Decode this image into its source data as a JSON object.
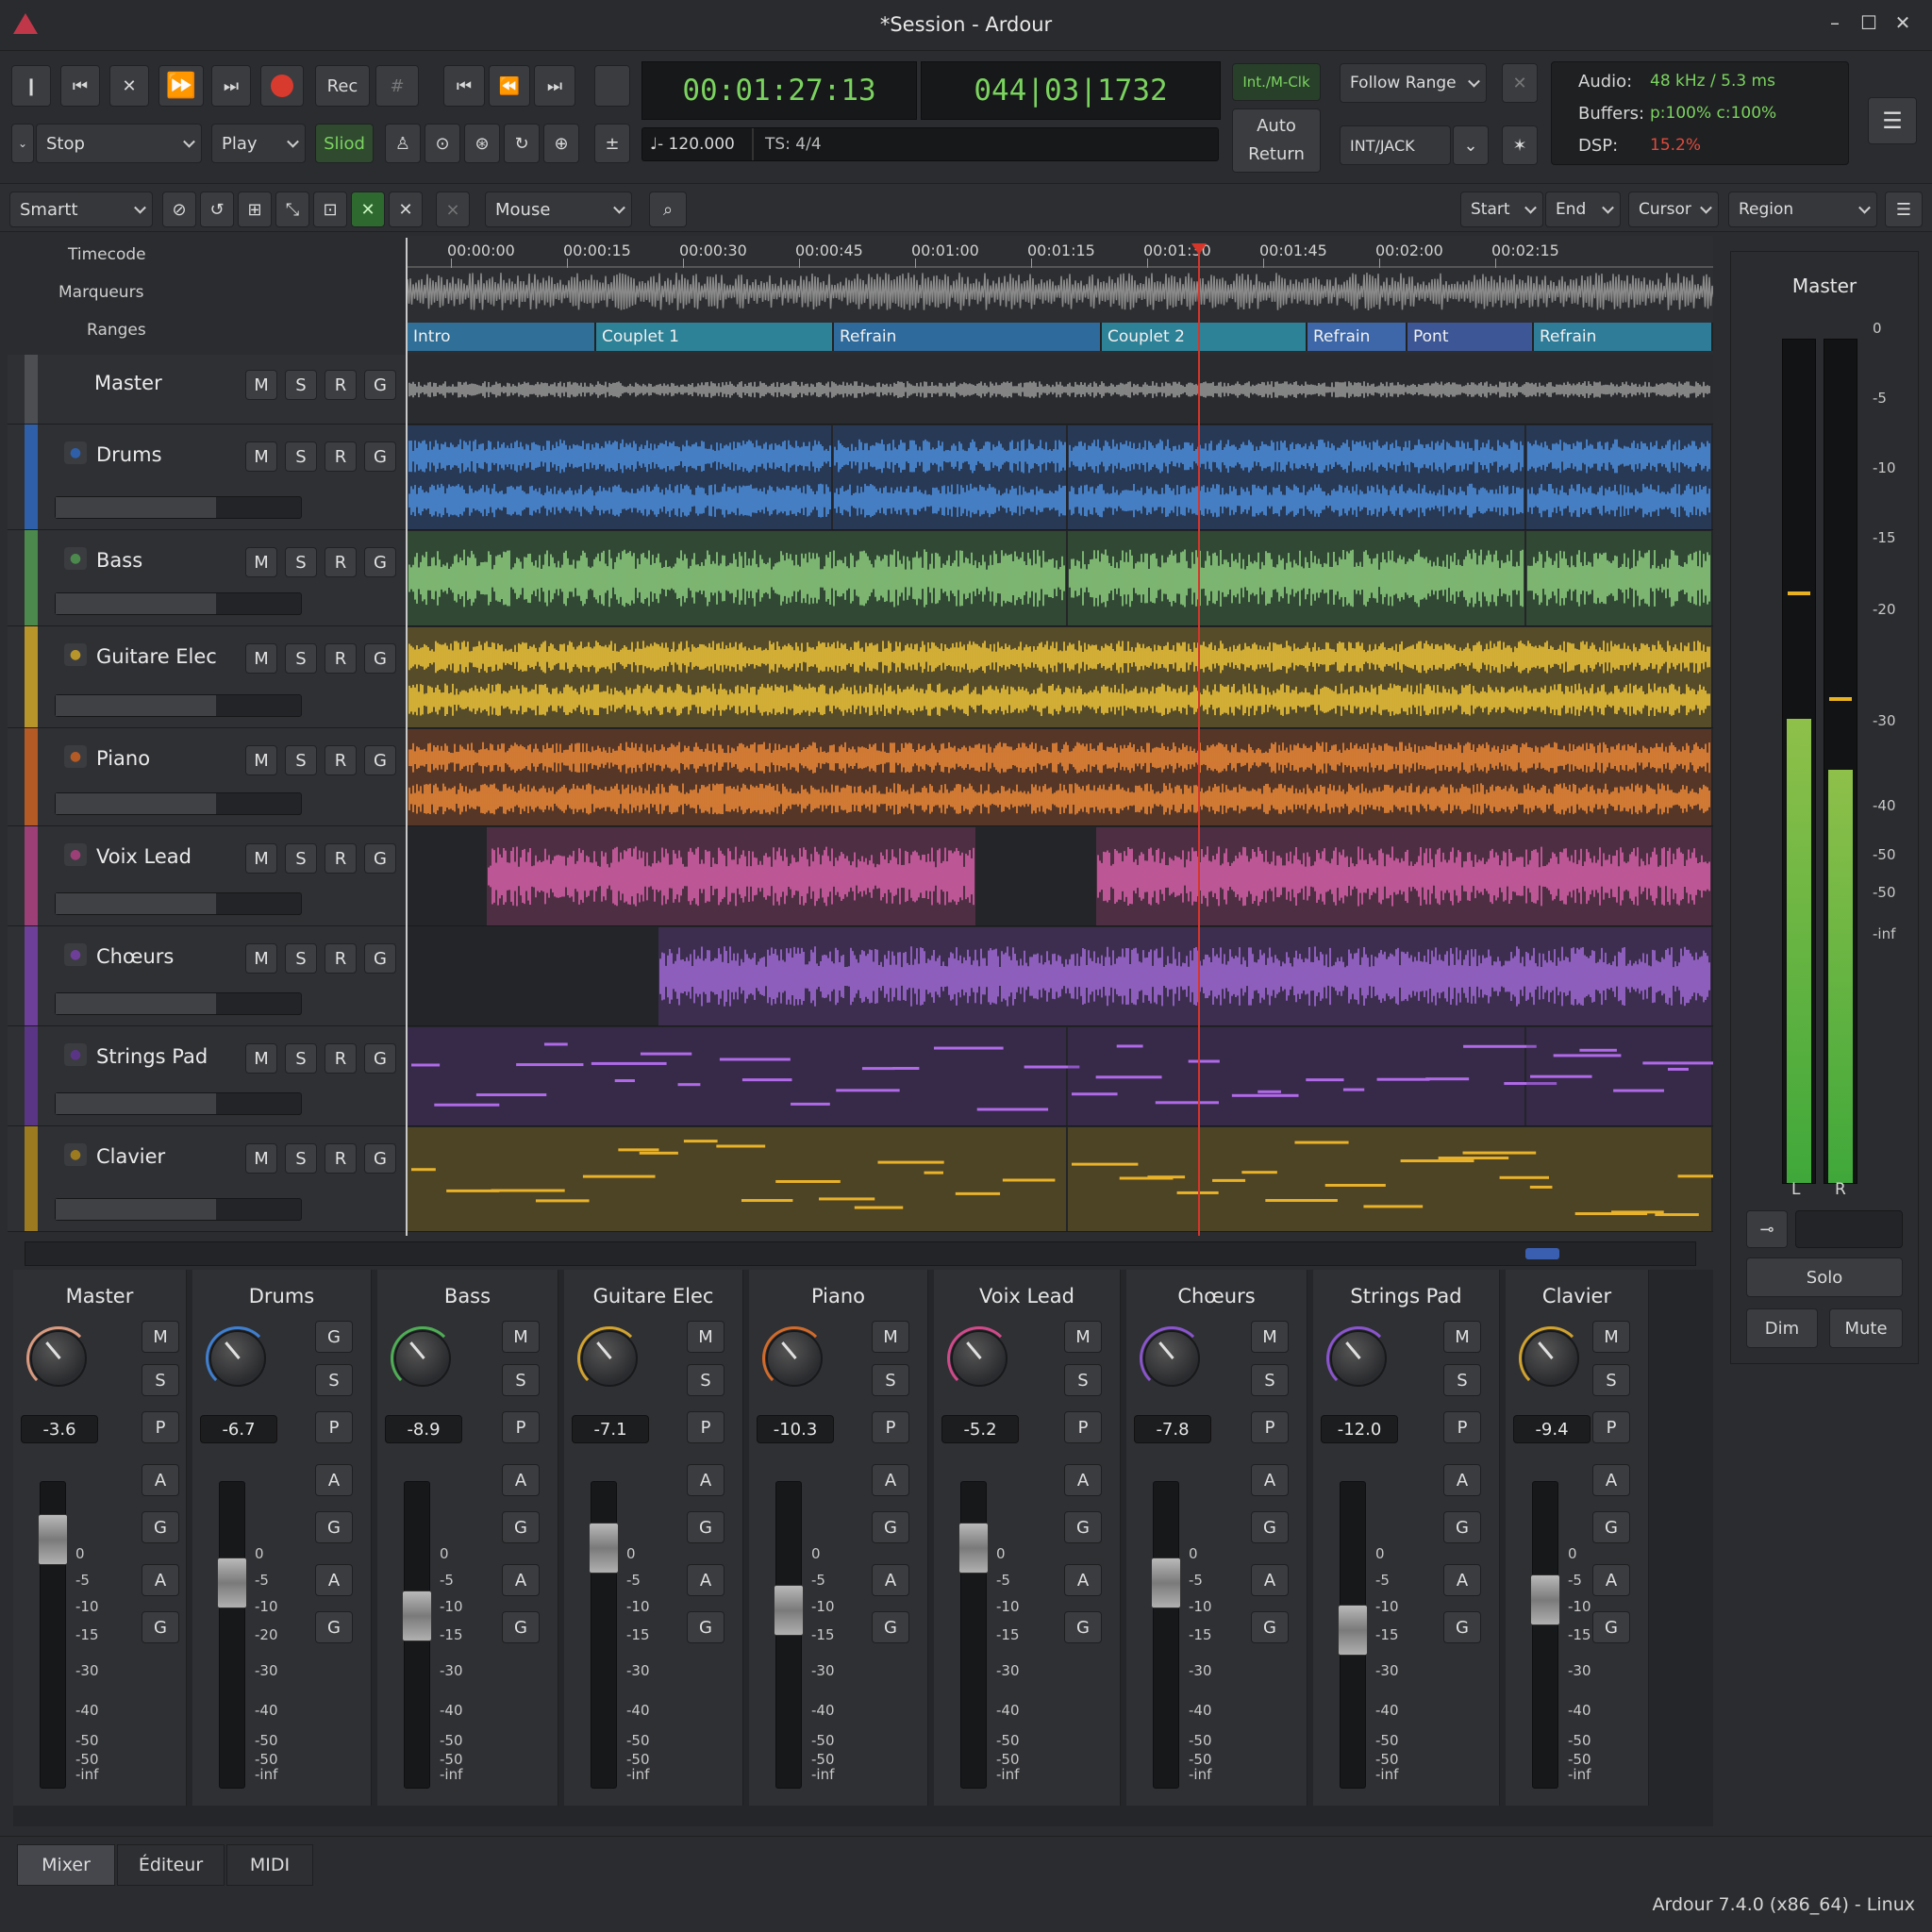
{
  "window": {
    "title": "*Session - Ardour",
    "min": "–",
    "max": "☐",
    "close": "✕"
  },
  "transport": {
    "rec_label": "Rec",
    "primary_clock": "00:01:27:13",
    "secondary_clock": "044|03|1732",
    "sync_label": "Int./M-Clk",
    "follow_range": "Follow Range",
    "auto_return_1": "Auto",
    "auto_return_2": "Return",
    "jack": "INT/JACK",
    "stop_label": "Stop",
    "play_label": "Play",
    "slide_label": "Sliod",
    "tempo": "♩- 120.000",
    "ts": "TS:  4/4"
  },
  "status": {
    "audio_label": "Audio:",
    "audio_value": "48 kHz / 5.3 ms",
    "buffers_label": "Buffers:",
    "buffers_value": "p:100% c:100%",
    "dsp_label": "DSP:",
    "dsp_value": "15.2%"
  },
  "edit_toolbar": {
    "edit_mode": "Smartt",
    "mouse_mode": "Mouse",
    "start": "Start",
    "end": "End",
    "cursor": "Cursor",
    "region": "Region"
  },
  "ruler": {
    "labels": [
      "Timecode",
      "Marqueurs",
      "Ranges"
    ],
    "ticks": [
      "00:00:00",
      "00:00:15",
      "00:00:30",
      "00:00:45",
      "00:01:00",
      "00:01:15",
      "00:01:30",
      "00:01:45",
      "00:02:00",
      "00:02:15"
    ],
    "ranges": [
      {
        "name": "Intro",
        "color": "#2f6f98"
      },
      {
        "name": "Couplet 1",
        "color": "#2e8298"
      },
      {
        "name": "Refrain",
        "color": "#2e6a9c"
      },
      {
        "name": "Couplet 2",
        "color": "#2e8298"
      },
      {
        "name": "Refrain",
        "color": "#3d67a8"
      },
      {
        "name": "Pont",
        "color": "#3d5796"
      },
      {
        "name": "Refrain",
        "color": "#2e7c98"
      }
    ]
  },
  "tracks": [
    {
      "name": "Master",
      "color": "#4d4e52",
      "btns": [
        "M",
        "S",
        "R",
        "G"
      ]
    },
    {
      "name": "Drums",
      "color": "#2f5fa8",
      "btns": [
        "M",
        "S",
        "R",
        "G"
      ]
    },
    {
      "name": "Bass",
      "color": "#4b8a4c",
      "btns": [
        "M",
        "S",
        "R",
        "G"
      ]
    },
    {
      "name": "Guitare Elec",
      "color": "#b8952a",
      "btns": [
        "M",
        "S",
        "R",
        "G"
      ]
    },
    {
      "name": "Piano",
      "color": "#b45a25",
      "btns": [
        "M",
        "S",
        "R",
        "G"
      ]
    },
    {
      "name": "Voix Lead",
      "color": "#9b3f76",
      "btns": [
        "M",
        "S",
        "R",
        "G"
      ]
    },
    {
      "name": "Chœurs",
      "color": "#6d3f98",
      "btns": [
        "M",
        "S",
        "R",
        "G"
      ]
    },
    {
      "name": "Strings Pad",
      "color": "#5a3585",
      "btns": [
        "M",
        "S",
        "R",
        "G"
      ]
    },
    {
      "name": "Clavier",
      "color": "#9c7a1f",
      "btns": [
        "M",
        "S",
        "R",
        "G"
      ]
    }
  ],
  "master_meter": {
    "title": "Master",
    "scale": [
      "0",
      "-5",
      "-10",
      "-15",
      "-20",
      "-30",
      "-40",
      "-50",
      "-50",
      "-inf"
    ],
    "left_label": "L",
    "right_label": "R",
    "solo": "Solo",
    "dim": "Dim",
    "mute": "Mute",
    "level_left": 0.55,
    "level_right": 0.49
  },
  "mixer": [
    {
      "name": "Master",
      "gain": "-3.6",
      "ring": "#d99a80",
      "top_btn": "M",
      "fader": 0.88
    },
    {
      "name": "Drums",
      "gain": "-6.7",
      "ring": "#3f7fd0",
      "top_btn": "G",
      "fader": 0.72
    },
    {
      "name": "Bass",
      "gain": "-8.9",
      "ring": "#4fae55",
      "top_btn": "M",
      "fader": 0.6
    },
    {
      "name": "Guitare Elec",
      "gain": "-7.1",
      "ring": "#d2a32e",
      "top_btn": "M",
      "fader": 0.85
    },
    {
      "name": "Piano",
      "gain": "-10.3",
      "ring": "#d06b2c",
      "top_btn": "M",
      "fader": 0.62
    },
    {
      "name": "Voix Lead",
      "gain": "-5.2",
      "ring": "#d04a8a",
      "top_btn": "M",
      "fader": 0.85
    },
    {
      "name": "Chœurs",
      "gain": "-7.8",
      "ring": "#8a55cc",
      "top_btn": "M",
      "fader": 0.72
    },
    {
      "name": "Strings Pad",
      "gain": "-12.0",
      "ring": "#8a55cc",
      "top_btn": "M",
      "fader": 0.55
    },
    {
      "name": "Clavier",
      "gain": "-9.4",
      "ring": "#d0a22e",
      "top_btn": "M",
      "fader": 0.66
    }
  ],
  "mixer_buttons": {
    "s": "S",
    "p": "P",
    "a": "A",
    "g": "G"
  },
  "fader_scale": [
    "0",
    "-5",
    "-10",
    "-15",
    "-30",
    "-40",
    "-50",
    "-50",
    "-inf"
  ],
  "drums_scale_alt": "-20",
  "tabs": [
    "Mixer",
    "Éditeur",
    "MIDI"
  ],
  "footer": "Ardour 7.4.0 (x86_64) - Linux"
}
